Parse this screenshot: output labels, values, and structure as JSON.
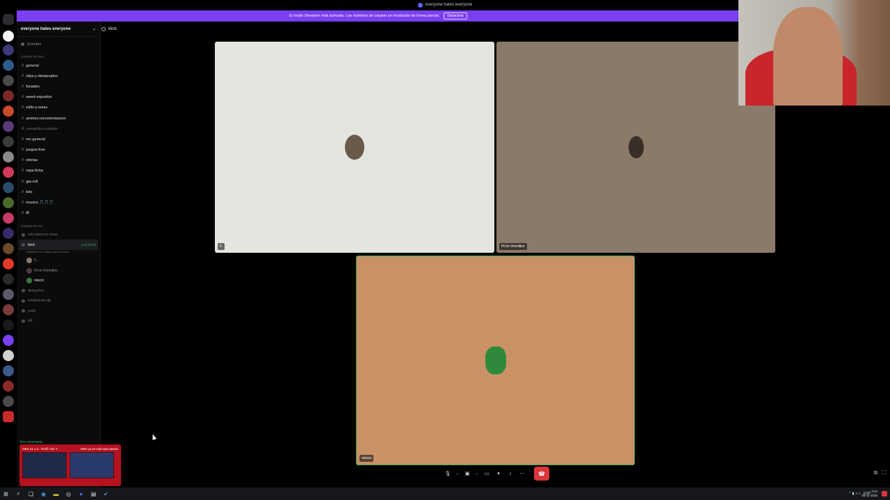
{
  "window": {
    "title": "everyone hates everyone"
  },
  "banner": {
    "text": "El modo Streamer está activado. Los nombres de usuario se mostrarán de forma parcial.",
    "button": "Desactivar"
  },
  "server": {
    "name": "everyone hates everyone",
    "events_label": "Eventos"
  },
  "categories": {
    "text": "Canales de texto",
    "voice": "Canales de voz"
  },
  "text_channels": [
    {
      "name": "general",
      "muted": false
    },
    {
      "name": "clips-y-destacados",
      "muted": false
    },
    {
      "name": "funados",
      "muted": false
    },
    {
      "name": "weed-expositor",
      "muted": false
    },
    {
      "name": "edits-y-weas",
      "muted": false
    },
    {
      "name": "animes-recomendacion",
      "muted": false
    },
    {
      "name": "comandos-counter",
      "muted": true
    },
    {
      "name": "mc-general",
      "muted": false
    },
    {
      "name": "juegos-free",
      "muted": false
    },
    {
      "name": "ofertas",
      "muted": false
    },
    {
      "name": "ropa-ficha",
      "muted": false
    },
    {
      "name": "gta-roll",
      "muted": false
    },
    {
      "name": "bdo",
      "muted": false
    },
    {
      "name": "musica 🎵🎵🎵",
      "muted": false
    },
    {
      "name": "tft",
      "muted": false
    }
  ],
  "voice_channels": {
    "before": [
      "solo-para-ver-weas"
    ],
    "active": {
      "name": "kkck",
      "timer": "1:01:36:46",
      "status": "Establecer un estado para el canal"
    },
    "users": [
      "F...",
      "Hi Im Vermilion",
      "rakzzz"
    ],
    "after": [
      "deepychor",
      "estalelando-gb",
      "pubg",
      "afk"
    ]
  },
  "voice_status": "Voz conectada",
  "channel_header": {
    "name": "kkck"
  },
  "tiles": [
    {
      "name": "F.",
      "bg": "#e3e5df"
    },
    {
      "name": "Hi Im Vermilion",
      "bg": "#8a7a6a"
    },
    {
      "name": "rakzzz",
      "bg": "#c89166"
    }
  ],
  "obs_popup": {
    "left": "OBS 31.1.2 - Perfil: Sin T...",
    "right": "OBS ya se está ejecutando"
  },
  "taskbar": {
    "lang": "ESP",
    "time": "3:44",
    "date": "08-11-2025"
  },
  "colors": {
    "accent": "#7a3ff0",
    "hangup": "#da373c",
    "speaking": "#3ba55d"
  }
}
